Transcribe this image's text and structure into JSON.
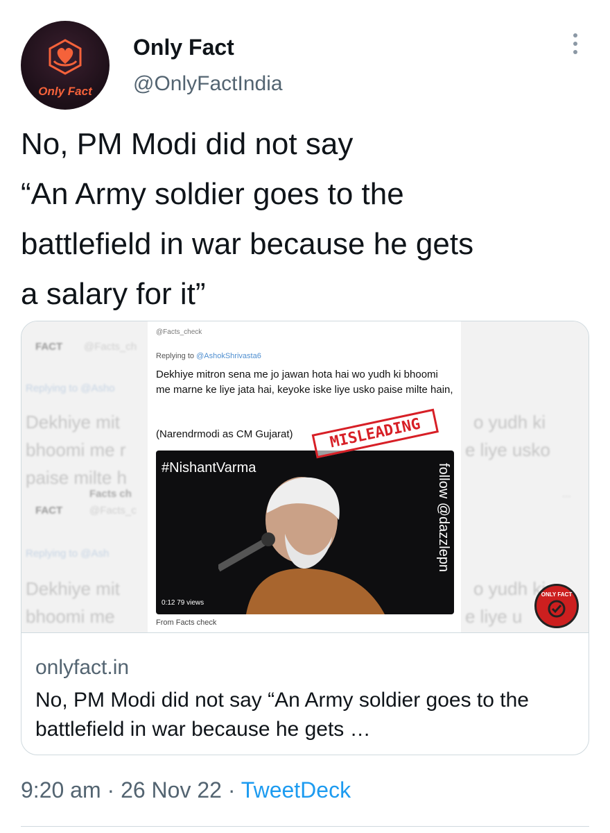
{
  "author": {
    "display_name": "Only Fact",
    "handle": "@OnlyFactIndia",
    "avatar_label": "Only Fact"
  },
  "tweet": {
    "text_lines": [
      "No, PM Modi did not say",
      "“An Army soldier goes to the",
      "battlefield in war because he gets",
      "a salary for it”"
    ]
  },
  "card": {
    "media": {
      "bg_left": {
        "header": "FACT",
        "header_sub": "@Facts_ch",
        "replying": "Replying to @Asho",
        "line1": "Dekhiye mit",
        "line2": "bhoomi me r",
        "line3": "paise milte h",
        "header2": "Facts ch",
        "header2_sub": "@Facts_c",
        "replying2": "Replying to @Ash",
        "line4": "Dekhiye mit",
        "line5": "bhoomi me"
      },
      "bg_right": {
        "line1": "o yudh ki",
        "line2": "e liye usko",
        "line3": "o yudh ki",
        "line4": "e liye u",
        "dots": "..."
      },
      "inner": {
        "header": "@Facts_check",
        "replying_prefix": "Replying to",
        "replying_handle": "@AshokShrivasta6",
        "body": "Dekhiye mitron sena me jo jawan hota hai wo yudh ki bhoomi me marne ke liye jata hai, keyoke iske liye usko paise milte hain,",
        "attribution": "(Narendrmodi as CM Gujarat)",
        "video_hashtag": "#NishantVarma",
        "video_side_text": "follow @dazzlepn",
        "video_time": "0:12  79 views",
        "from": "From Facts check"
      },
      "stamp": "MISLEADING",
      "badge": "ONLY FACT"
    },
    "domain": "onlyfact.in",
    "title": "No, PM Modi did not say “An Army soldier goes to the battlefield in war because he gets …"
  },
  "meta": {
    "time": "9:20 am",
    "separator": " · ",
    "date": "26 Nov 22",
    "source": "TweetDeck"
  },
  "colors": {
    "link": "#1d9bf0",
    "muted": "#536471",
    "stamp": "#d71f26"
  }
}
